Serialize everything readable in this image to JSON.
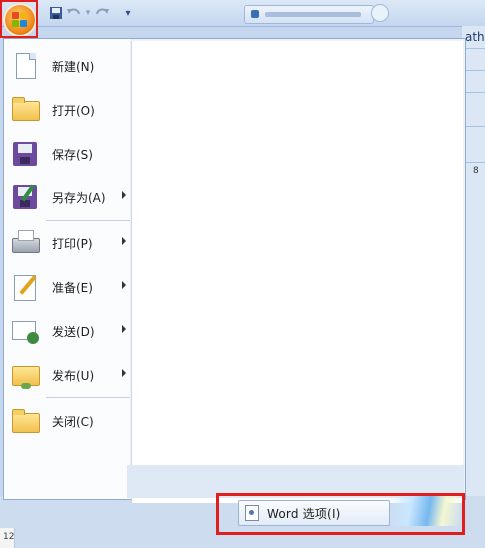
{
  "window": {
    "ribbon_peek_text": "ath",
    "ruler_number": "8",
    "side_ruler_number": "12"
  },
  "quick_access": {
    "save_icon": "save-icon",
    "undo_icon": "undo-icon",
    "redo_icon": "redo-icon",
    "customize_icon": "customize-dropdown-icon"
  },
  "menu": {
    "items": [
      {
        "label": "新建(N)",
        "icon": "new-document-icon",
        "has_submenu": false
      },
      {
        "label": "打开(O)",
        "icon": "open-folder-icon",
        "has_submenu": false
      },
      {
        "label": "保存(S)",
        "icon": "save-disk-icon",
        "has_submenu": false
      },
      {
        "label": "另存为(A)",
        "icon": "save-as-icon",
        "has_submenu": true
      },
      {
        "label": "打印(P)",
        "icon": "printer-icon",
        "has_submenu": true
      },
      {
        "label": "准备(E)",
        "icon": "prepare-icon",
        "has_submenu": true
      },
      {
        "label": "发送(D)",
        "icon": "send-icon",
        "has_submenu": true
      },
      {
        "label": "发布(U)",
        "icon": "publish-icon",
        "has_submenu": true
      },
      {
        "label": "关闭(C)",
        "icon": "close-folder-icon",
        "has_submenu": false
      }
    ],
    "options_button_label": "Word 选项(I)"
  },
  "colors": {
    "highlight_box": "#e01e1e",
    "office_button": "#f08a1a"
  }
}
